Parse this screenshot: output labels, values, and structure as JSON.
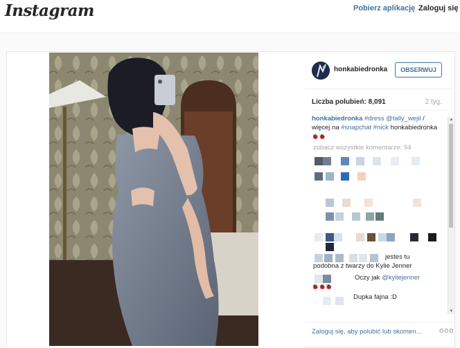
{
  "header": {
    "logo": "Instagram",
    "get_app": "Pobierz aplikację",
    "login": "Zaloguj się"
  },
  "post": {
    "owner": "honkabiedronka",
    "follow_button": "OBSERWUJ",
    "likes": "Liczba polubień: 8,091",
    "age": "2 tyg.",
    "caption": {
      "user": "honkabiedronka",
      "tag_dress": "#dress",
      "mention": "@tally_wejil",
      "slash": "/",
      "wiecej": "więcej na",
      "tag_snapchat": "#snapchat",
      "tag_nick": "#nick",
      "owner_repeat": "honkabiedronka",
      "emoji": "🐞🐞"
    },
    "view_all": "zobacz wszystkie komentarze: 94",
    "comments": [
      {
        "text": "jestes tu"
      },
      {
        "text": "podobna z twarzy do Kylie Jenner"
      },
      {
        "text": "Oczy jak",
        "mention": "@kyliejenner"
      },
      {
        "text": "🐞🐞🐞"
      },
      {
        "text": "Dupka fajna :D"
      }
    ],
    "footer_login": "Zaloguj się, aby polubić lub skomen...",
    "more": "ooo"
  },
  "colors": {
    "link_blue": "#3f729b",
    "muted_gray": "#a5a7aa",
    "text_dark": "#262626"
  },
  "icons": [
    "more-options-icon",
    "scroll-up-arrow-icon",
    "scroll-down-arrow-icon"
  ]
}
